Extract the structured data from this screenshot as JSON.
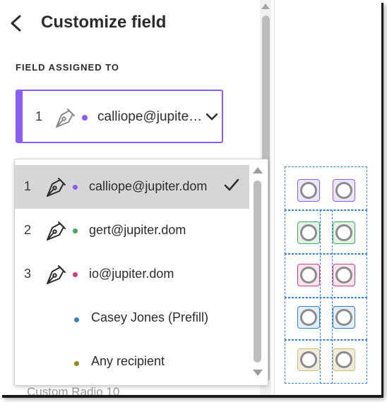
{
  "header": {
    "title": "Customize field"
  },
  "section": {
    "label": "FIELD ASSIGNED TO"
  },
  "selected": {
    "number": "1",
    "email": "calliope@jupiter.dom",
    "dot_color": "#8b5cf6"
  },
  "options": [
    {
      "number": "1",
      "label": "calliope@jupiter.dom",
      "dot_color": "#8b5cf6",
      "signer": true,
      "selected": true
    },
    {
      "number": "2",
      "label": "gert@jupiter.dom",
      "dot_color": "#3fa85b",
      "signer": true,
      "selected": false
    },
    {
      "number": "3",
      "label": "io@jupiter.dom",
      "dot_color": "#d43a7e",
      "signer": true,
      "selected": false
    },
    {
      "number": "",
      "label": "Casey Jones (Prefill)",
      "dot_color": "#2f7fd8",
      "signer": false,
      "selected": false
    },
    {
      "number": "",
      "label": "Any recipient",
      "dot_color": "#9c8a18",
      "signer": false,
      "selected": false
    }
  ],
  "behind_field": {
    "label": "Custom Radio 10"
  },
  "canvas_rows": [
    {
      "fill": "#ece6fb",
      "border": "#8b5cf6"
    },
    {
      "fill": "#e3f3e6",
      "border": "#3fa85b"
    },
    {
      "fill": "#fbe4ee",
      "border": "#d43a7e"
    },
    {
      "fill": "#e4eefb",
      "border": "#2f7fd8"
    },
    {
      "fill": "#f1edda",
      "border": "#b8a84a"
    }
  ]
}
